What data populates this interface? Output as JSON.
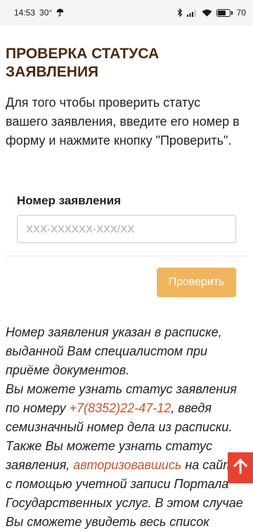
{
  "status_bar": {
    "time": "14:53",
    "temperature": "30°",
    "battery": "70",
    "battery_level": 0.7
  },
  "page": {
    "title": "ПРОВЕРКА СТАТУСА ЗАЯВЛЕНИЯ",
    "intro": "Для того чтобы проверить статус вашего заявления, введите его номер в форму и нажмите кнопку \"Проверить\"."
  },
  "form": {
    "field_label": "Номер заявления",
    "field_placeholder": "XXX-XXXXXX-XXX/XX",
    "field_value": "",
    "submit_label": "Проверить"
  },
  "info": {
    "p1": "Номер заявления указан в расписке, выданной Вам специалистом при приёме документов.",
    "p2_before": "Вы можете узнать статус заявления по номеру ",
    "phone": "+7(8352)22-47-12",
    "p2_after": ", введя семизначный номер дела из расписки.",
    "p3_before": "Также Вы можете узнать статус заявления, ",
    "auth_link": "авторизовавшись",
    "p3_after": " на сайте с помощью учетной записи Портала Государственных услуг. В этом случае Вы сможете увидеть весь список услуг,"
  },
  "colors": {
    "title": "#4a2a14",
    "button": "#f0b55c",
    "link": "#c8552f",
    "scroll_top": "#e8412f"
  },
  "icons": {
    "weather": "umbrella-icon",
    "bluetooth": "bluetooth-icon",
    "signal": "signal-icon",
    "wifi": "wifi-icon",
    "scroll_top": "arrow-up-icon"
  }
}
